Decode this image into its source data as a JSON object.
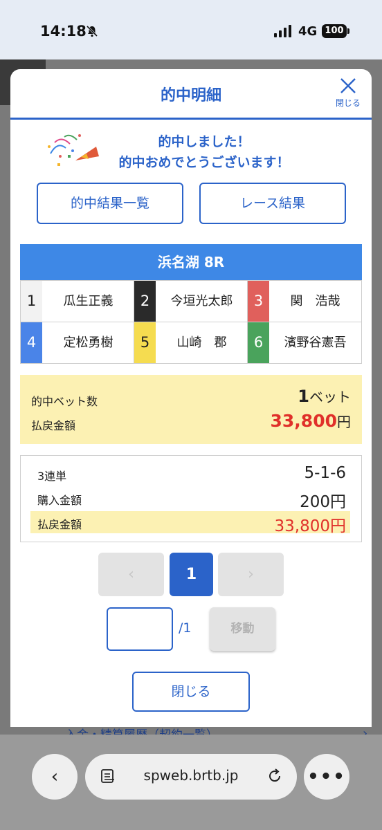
{
  "status": {
    "time": "14:18",
    "network": "4G",
    "battery": "100"
  },
  "backdrop": {
    "bottom_text": "入金・精算履歴（契約一覧）"
  },
  "modal": {
    "title": "的中明細",
    "close_label": "閉じる",
    "message_line1": "的中しました！",
    "message_line2": "的中おめでとうございます！",
    "btn_hit_list": "的中結果一覧",
    "btn_race_result": "レース結果",
    "race": {
      "header": "浜名湖 8R",
      "racers": [
        {
          "num": "1",
          "name": "瓜生正義"
        },
        {
          "num": "2",
          "name": "今垣光太郎"
        },
        {
          "num": "3",
          "name": "関　浩哉"
        },
        {
          "num": "4",
          "name": "定松勇樹"
        },
        {
          "num": "5",
          "name": "山崎　郡"
        },
        {
          "num": "6",
          "name": "濱野谷憲吾"
        }
      ]
    },
    "summary": {
      "bets_label": "的中ベット数",
      "bets_value": "1",
      "bets_unit": "ベット",
      "payout_label": "払戻金額",
      "payout_value": "33,800",
      "payout_unit": "円"
    },
    "detail": {
      "type_label": "3連単",
      "type_value": "5-1-6",
      "purchase_label": "購入金額",
      "purchase_value": "200円",
      "payout_label": "払戻金額",
      "payout_value": "33,800円"
    },
    "pagination": {
      "prev": "‹",
      "current": "1",
      "next": "›",
      "input_value": "",
      "total": "/1",
      "move_label": "移動"
    },
    "close_button": "閉じる"
  },
  "browser": {
    "url": "spweb.brtb.jp",
    "more": "•••",
    "back": "‹"
  }
}
